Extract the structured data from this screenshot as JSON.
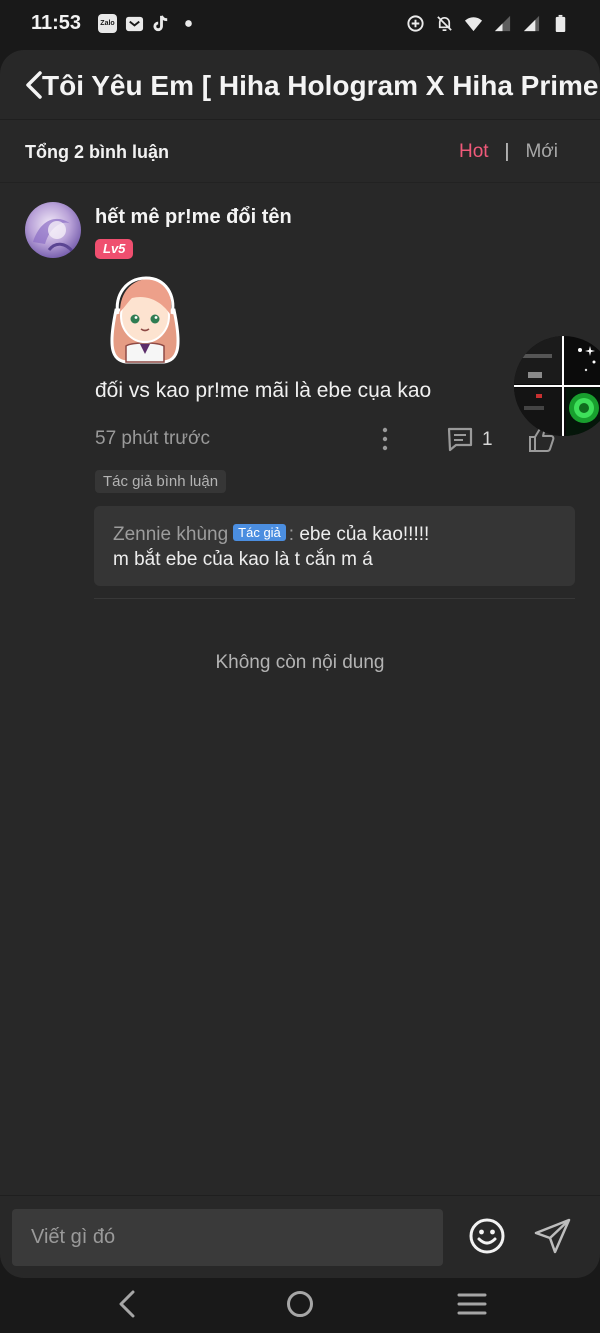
{
  "status_bar": {
    "time": "11:53",
    "zalo_label": "Zalo",
    "icons": [
      "zalo-icon",
      "mail-icon",
      "tiktok-icon",
      "dot-icon",
      "data-saver-icon",
      "mute-icon",
      "wifi-icon",
      "signal-icon",
      "signal-icon",
      "battery-icon"
    ]
  },
  "header": {
    "title": "Tôi Yêu Em [ Hiha Hologram X Hiha Prime ]"
  },
  "comments_bar": {
    "total_label": "Tổng 2 bình luận",
    "sort_hot": "Hot",
    "separator": "|",
    "sort_new": "Mới"
  },
  "comment": {
    "username": "hết mê pr!me đổi tên",
    "level": "Lv5",
    "text": "đối vs kao pr!me mãi là ebe cụa kao",
    "time": "57 phút trước",
    "reply_count": "1",
    "author_tag": "Tác giả bình luận",
    "reply": {
      "name": "Zennie khùng",
      "tag": "Tác giả",
      "separator": ":",
      "message": "ebe của kao!!!!!",
      "message_line2": "m bắt ebe của kao là t cắn m á"
    }
  },
  "end_text": "Không còn nội dung",
  "input": {
    "placeholder": "Viết gì đó"
  },
  "colors": {
    "accent_hot": "#f05a7a",
    "level_badge": "#ef4f6f",
    "author_tag_blue": "#4b8ee0",
    "background": "#282828"
  }
}
